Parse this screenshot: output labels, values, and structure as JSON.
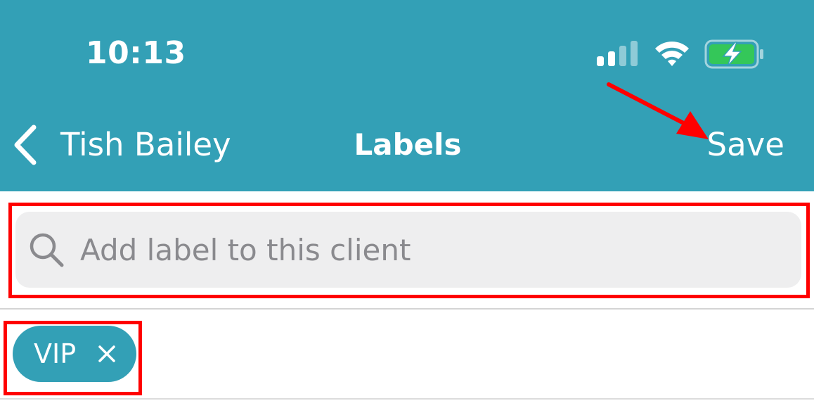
{
  "status_bar": {
    "time": "10:13",
    "signal_icon": "cellular-signal-icon",
    "wifi_icon": "wifi-icon",
    "battery_icon": "battery-charging-icon"
  },
  "nav": {
    "back_label": "Tish Bailey",
    "title": "Labels",
    "save_label": "Save",
    "back_icon": "chevron-left-icon"
  },
  "search": {
    "placeholder": "Add label to this client",
    "value": "",
    "icon": "search-icon"
  },
  "labels": [
    {
      "text": "VIP",
      "remove_icon": "close-icon"
    }
  ],
  "colors": {
    "header_bg": "#33a0b6",
    "chip_bg": "#33a0b6",
    "search_bg": "#eeeeef",
    "annotation": "#ff0000",
    "battery_fill": "#34c759"
  }
}
